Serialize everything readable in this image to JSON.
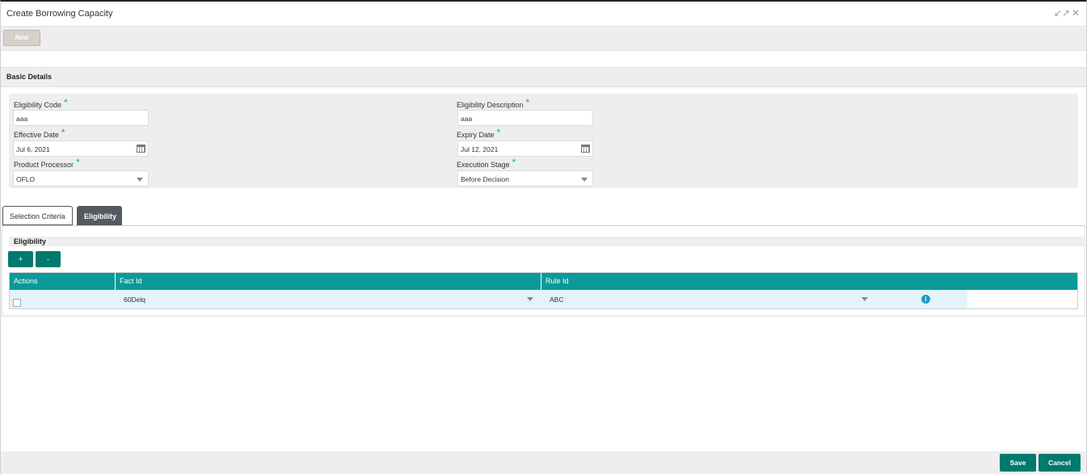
{
  "window": {
    "title": "Create Borrowing Capacity",
    "minimize_icon": "↙↗",
    "close_icon": "✕"
  },
  "toolbar": {
    "new_label": "New"
  },
  "basic_details": {
    "heading": "Basic Details",
    "required_mark": "*",
    "eligibility_code": {
      "label": "Eligibility Code",
      "value": "aaa"
    },
    "eligibility_description": {
      "label": "Eligibility Description",
      "value": "aaa"
    },
    "effective_date": {
      "label": "Effective Date",
      "value": "Jul 6, 2021"
    },
    "expiry_date": {
      "label": "Expiry Date",
      "value": "Jul 12, 2021"
    },
    "product_processor": {
      "label": "Product Processor",
      "value": "OFLO"
    },
    "execution_stage": {
      "label": "Execution Stage",
      "value": "Before Decision"
    }
  },
  "tabs": [
    {
      "label": "Selection Criteria",
      "active": false
    },
    {
      "label": "Eligibility",
      "active": true
    }
  ],
  "eligibility": {
    "heading": "Eligibility",
    "add_label": "+",
    "remove_label": "-",
    "columns": [
      "Actions",
      "Fact Id",
      "Rule Id"
    ],
    "rows": [
      {
        "fact_id": "60Delq",
        "rule_id": "ABC",
        "info_icon": "i"
      }
    ]
  },
  "footer": {
    "save_label": "Save",
    "cancel_label": "Cancel"
  },
  "colors": {
    "accent": "#007a6e",
    "table_header": "#0b9999",
    "required": "#1b9fc6"
  }
}
